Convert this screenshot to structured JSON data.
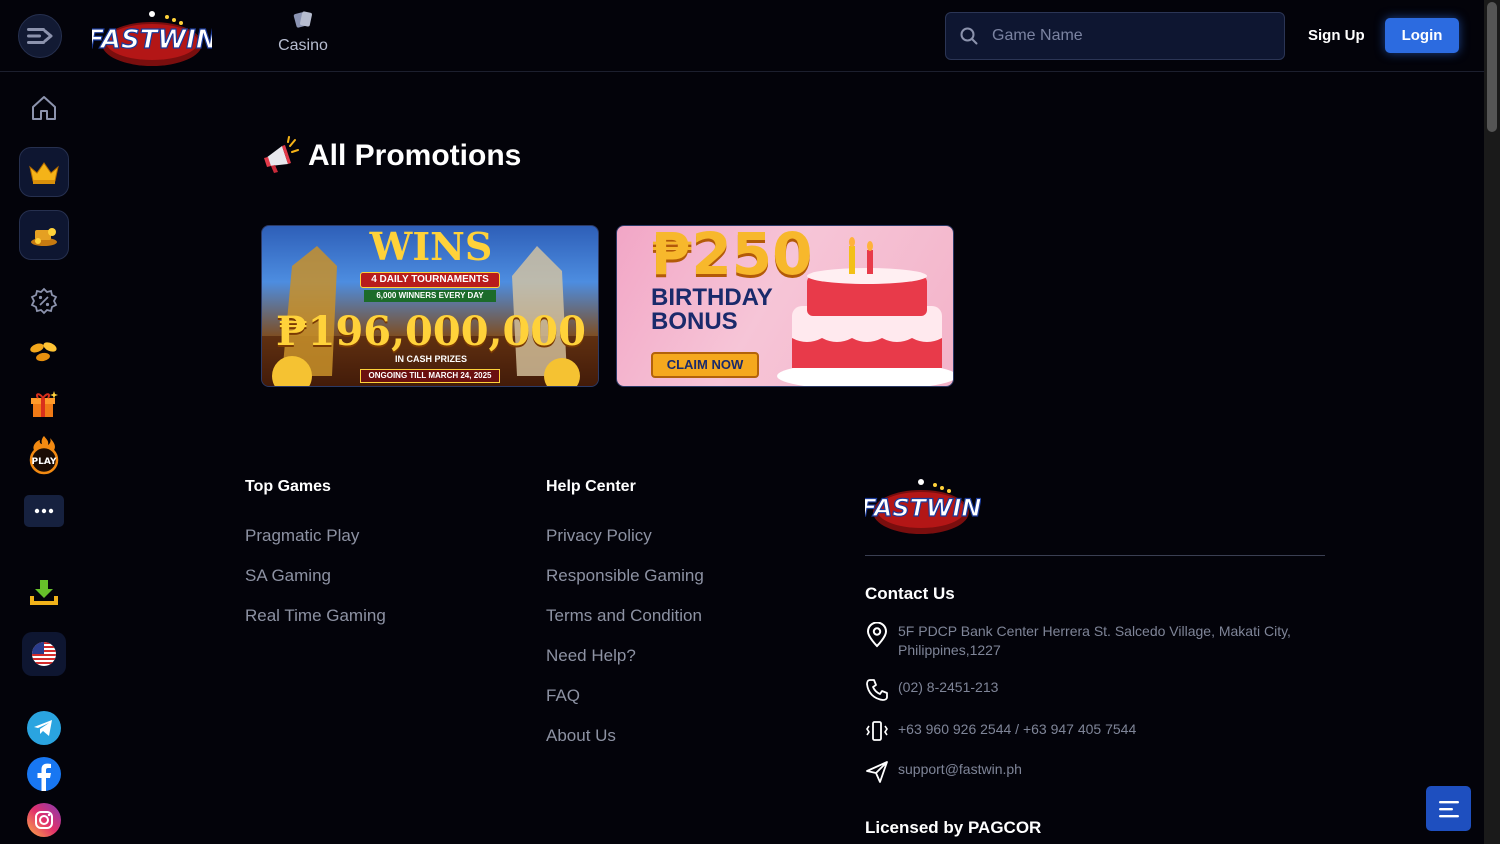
{
  "header": {
    "logo_text": "FASTWIN",
    "nav_tab": "Casino",
    "search_placeholder": "Game Name",
    "signup_label": "Sign Up",
    "login_label": "Login"
  },
  "sidebar": {
    "items": [
      {
        "icon": "home-icon"
      },
      {
        "icon": "crown-icon"
      },
      {
        "icon": "treasure-icon"
      },
      {
        "icon": "promo-percent-icon"
      },
      {
        "icon": "coins-icon"
      },
      {
        "icon": "gift-icon"
      },
      {
        "icon": "pragmatic-play-icon",
        "label": "PLAY"
      },
      {
        "icon": "more-icon"
      },
      {
        "icon": "download-icon"
      },
      {
        "icon": "us-flag-icon"
      },
      {
        "icon": "telegram-icon"
      },
      {
        "icon": "facebook-icon"
      },
      {
        "icon": "instagram-icon"
      }
    ]
  },
  "main": {
    "title": "All Promotions",
    "promos": [
      {
        "headline": "WINS",
        "line1": "4 DAILY TOURNAMENTS",
        "line2": "6,000 WINNERS EVERY DAY",
        "amount": "₱196,000,000",
        "line3": "IN CASH PRIZES",
        "line4": "ONGOING TILL MARCH 24, 2025"
      },
      {
        "amount": "₱250",
        "title1": "BIRTHDAY",
        "title2": "BONUS",
        "cta": "CLAIM NOW"
      }
    ]
  },
  "footer": {
    "top_games": {
      "title": "Top Games",
      "links": [
        "Pragmatic Play",
        "SA Gaming",
        "Real Time Gaming"
      ]
    },
    "help_center": {
      "title": "Help Center",
      "links": [
        "Privacy Policy",
        "Responsible Gaming",
        "Terms and Condition",
        "Need Help?",
        "FAQ",
        "About Us"
      ]
    },
    "contact": {
      "title": "Contact Us",
      "address": "5F PDCP Bank Center Herrera St. Salcedo Village, Makati City, Philippines,1227",
      "phone": "(02) 8-2451-213",
      "mobile": "+63 960 926 2544 / +63 947 405 7544",
      "email": "support@fastwin.ph",
      "licensed": "Licensed by PAGCOR"
    }
  },
  "colors": {
    "background": "#03030a",
    "accent": "#2c6be0",
    "panel": "#0e1631",
    "muted_text": "#8d92a3"
  }
}
